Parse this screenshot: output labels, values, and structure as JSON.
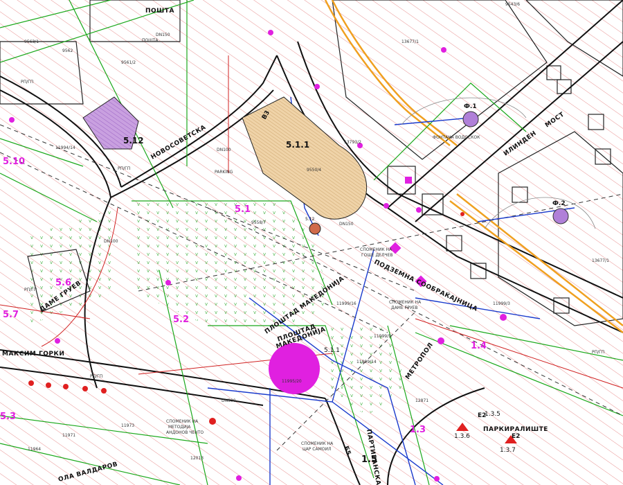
{
  "streets": {
    "posta_top": "ПОШТА",
    "ploshtad_makedonija": "ПЛОШТАД МАКЕДОНИЈА",
    "ploshtad_makedonija_center": "ПЛОШТАД",
    "ploshtad_makedonija_center2": "МАКЕДОНИЈА",
    "podzemna": "ПОДЗЕМНА СООБРАЌАЈНИЦА",
    "maksim_gorki": "МАКСИМ ГОРКИ",
    "most": "МОСТ",
    "ilinden": "ИЛИНДЕН",
    "novosovetska": "НОВОСОВЕТСКА",
    "dame_gruev": "ДАМЕ ГРУЕВ",
    "partizanska": "ПАРТИЗАНСКА",
    "valdarov": "ОЛА ВАЛДАРОВ",
    "metropol": "МЕТРОПОЛ",
    "parkiranje": "ПАРКИРАЛИШТЕ",
    "parking": "PARKING",
    "posta_left": "ПОШТА"
  },
  "zones": {
    "z512": "5.12",
    "z511": "5.1.1",
    "z51": "5.1",
    "z510": "5.10",
    "z56": "5.6",
    "z57": "5.7",
    "z52": "5.2",
    "z53": "5.3",
    "z14": "1.4",
    "z13": "1.3",
    "z15": "1.5",
    "z512b": "5.12",
    "z511b": "5.1.1",
    "z136": "1.3.6",
    "z137": "1.3.7",
    "z135": "1.3.5"
  },
  "codes": {
    "f1": "Ф.1",
    "f2": "Ф.2",
    "b5": "Б5",
    "e2a": "Е2",
    "e2b": "Е2",
    "b3": "В3",
    "ppgp1": "РП/ГП",
    "ppgp2": "РП/ГП",
    "ppgp3": "РП/ГП",
    "ppgp4": "РП/ГП",
    "ppgp5": "РП/ГП",
    "dn1": "DN150",
    "dn2": "DN100",
    "dn3": "DN300",
    "dn4": "DN150",
    "dn5": "DN100"
  },
  "parcels": {
    "p1": "9562",
    "p2": "9563/1",
    "p3": "9561/2",
    "p4": "13677/1",
    "p5": "9543/6",
    "p6": "11994/14",
    "p7": "13793/2",
    "p8": "9550/4",
    "p9": "9558/7",
    "p10": "11999/16",
    "p11": "11999/3",
    "p12": "11999/5",
    "p13": "12871",
    "p14": "11995/20",
    "p15": "11971",
    "p16": "11973",
    "p17": "11964",
    "p18": "13677/1",
    "p19": "11999/14",
    "p20": "12013"
  },
  "notes": {
    "n1": "СПОМЕНИК НА",
    "n2": "ДАМЕ ГРУЕВ",
    "n3": "СПОМЕНИК НА",
    "n4": "ГОШЕ ДЕЛЧЕВ",
    "n5": "СПОМЕНИК НА",
    "n6": "ЦАР САМОИЛ",
    "n7": "СПОМЕНИК НА",
    "n8": "МЕТОДИЈА",
    "n9": "АНДОНОВ ЧЕНТО",
    "n10": "ФОНТАНА ВОДОСКОК"
  },
  "colors": {
    "magenta": "#e020e0",
    "green": "#1aa81a",
    "blue": "#1a3acc",
    "hatch": "#e04a4a",
    "orange": "#f0a020",
    "tan": "#e8c89a",
    "purple": "#b080d8"
  }
}
